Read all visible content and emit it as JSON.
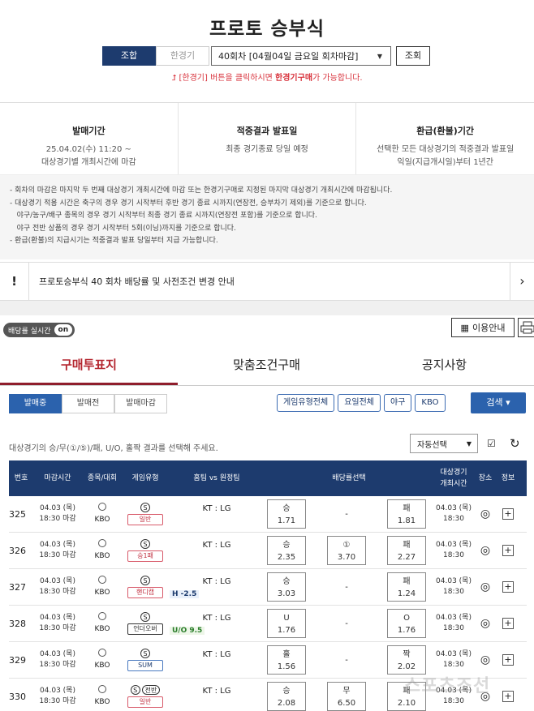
{
  "page_title": "프로토 승부식",
  "mode": {
    "combo": "조합",
    "single": "한경기"
  },
  "round_select": "40회차 [04월04일 금요일 회차마감]",
  "lookup": "조회",
  "red_notice": {
    "pre": "[한경기] 버튼을 클릭하시면 ",
    "bold": "한경기구매",
    "post": "가 가능합니다."
  },
  "info": [
    {
      "title": "발매기간",
      "lines": [
        "25.04.02(수) 11:20 ~",
        "대상경기별 개최시간에 마감"
      ]
    },
    {
      "title": "적중결과 발표일",
      "lines": [
        "최종 경기종료 당일 예정"
      ]
    },
    {
      "title": "환급(환불)기간",
      "lines": [
        "선택한 모든 대상경기의 적중결과 발표일",
        "익일(지급개시일)부터 1년간"
      ]
    }
  ],
  "rules": [
    "- 회차의 마감은 마지막 두 번째 대상경기 개최시간에 마감 또는 한경기구매로 지정된 마지막 대상경기 개최시간에 마감됩니다.",
    "- 대상경기 적용 시간은 축구의 경우 경기 시작부터 후반 경기 종료 시까지(연장전, 승부차기 제외)를 기준으로 합니다.",
    "   야구/농구/배구 종목의 경우 경기 시작부터 최종 경기 종료 시까지(연장전 포함)를 기준으로 합니다.",
    "   야구 전반 상품의 경우 경기 시작부터 5회(이닝)까지를 기준으로 합니다.",
    "- 환급(환불)의 지급시기는 적중결과 발표 당일부터 지급 가능합니다."
  ],
  "announce": {
    "icon": "!",
    "text": "프로토승부식 40 회차 배당률 및 사전조건 변경 안내",
    "arrow": "›"
  },
  "realtime": {
    "label": "배당률 실시간",
    "state": "on"
  },
  "guide_label": "이용안내",
  "tabs": [
    "구매투표지",
    "맞춤조건구매",
    "공지사항"
  ],
  "status_tabs": [
    "발매중",
    "발매전",
    "발매마감"
  ],
  "filters": [
    "게임유형전체",
    "요일전체",
    "야구",
    "KBO"
  ],
  "search": "검색 ▾",
  "select_hint": "대상경기의 승/무(①/⑤)/패, U/O, 홀짝 결과를 선택해 주세요.",
  "auto_select": "자동선택",
  "headers": [
    "번호",
    "마감시간",
    "종목/대회",
    "게임유형",
    "홈팀 vs 원정팀",
    "배당률선택",
    "대상경기\n개최시간",
    "장소",
    "정보"
  ],
  "rows": [
    {
      "no": "325",
      "date": "04.03 (목)",
      "close": "18:30 마감",
      "league": "KBO",
      "s": "S",
      "s2": "",
      "type": "일반",
      "tcls": "",
      "match": "KT : LG",
      "hc": "",
      "o1l": "승",
      "o1v": "1.71",
      "o2l": "",
      "o2v": "-",
      "o3l": "패",
      "o3v": "1.81",
      "gd": "04.03 (목)",
      "gt": "18:30"
    },
    {
      "no": "326",
      "date": "04.03 (목)",
      "close": "18:30 마감",
      "league": "KBO",
      "s": "S",
      "s2": "",
      "type": "승1패",
      "tcls": "",
      "match": "KT : LG",
      "hc": "",
      "o1l": "승",
      "o1v": "2.35",
      "o2l": "①",
      "o2v": "3.70",
      "o3l": "패",
      "o3v": "2.27",
      "gd": "04.03 (목)",
      "gt": "18:30"
    },
    {
      "no": "327",
      "date": "04.03 (목)",
      "close": "18:30 마감",
      "league": "KBO",
      "s": "S",
      "s2": "",
      "type": "핸디캡",
      "tcls": "",
      "match": "KT : LG",
      "hc": "H -2.5",
      "o1l": "승",
      "o1v": "3.03",
      "o2l": "",
      "o2v": "-",
      "o3l": "패",
      "o3v": "1.24",
      "gd": "04.03 (목)",
      "gt": "18:30"
    },
    {
      "no": "328",
      "date": "04.03 (목)",
      "close": "18:30 마감",
      "league": "KBO",
      "s": "S",
      "s2": "",
      "type": "언더오버",
      "tcls": "dark",
      "match": "KT : LG",
      "hc": "U/O 9.5",
      "o1l": "U",
      "o1v": "1.76",
      "o2l": "",
      "o2v": "-",
      "o3l": "O",
      "o3v": "1.76",
      "gd": "04.03 (목)",
      "gt": "18:30"
    },
    {
      "no": "329",
      "date": "04.03 (목)",
      "close": "18:30 마감",
      "league": "KBO",
      "s": "S",
      "s2": "",
      "type": "SUM",
      "tcls": "blue",
      "match": "KT : LG",
      "hc": "",
      "o1l": "홀",
      "o1v": "1.56",
      "o2l": "",
      "o2v": "-",
      "o3l": "짝",
      "o3v": "2.02",
      "gd": "04.03 (목)",
      "gt": "18:30"
    },
    {
      "no": "330",
      "date": "04.03 (목)",
      "close": "18:30 마감",
      "league": "KBO",
      "s": "S",
      "s2": "전반",
      "type": "일반",
      "tcls": "",
      "match": "KT : LG",
      "hc": "",
      "o1l": "승",
      "o1v": "2.08",
      "o2l": "무",
      "o2v": "6.50",
      "o3l": "패",
      "o3v": "2.10",
      "gd": "04.03 (목)",
      "gt": "18:30"
    }
  ],
  "watermark": "스포츠조선"
}
